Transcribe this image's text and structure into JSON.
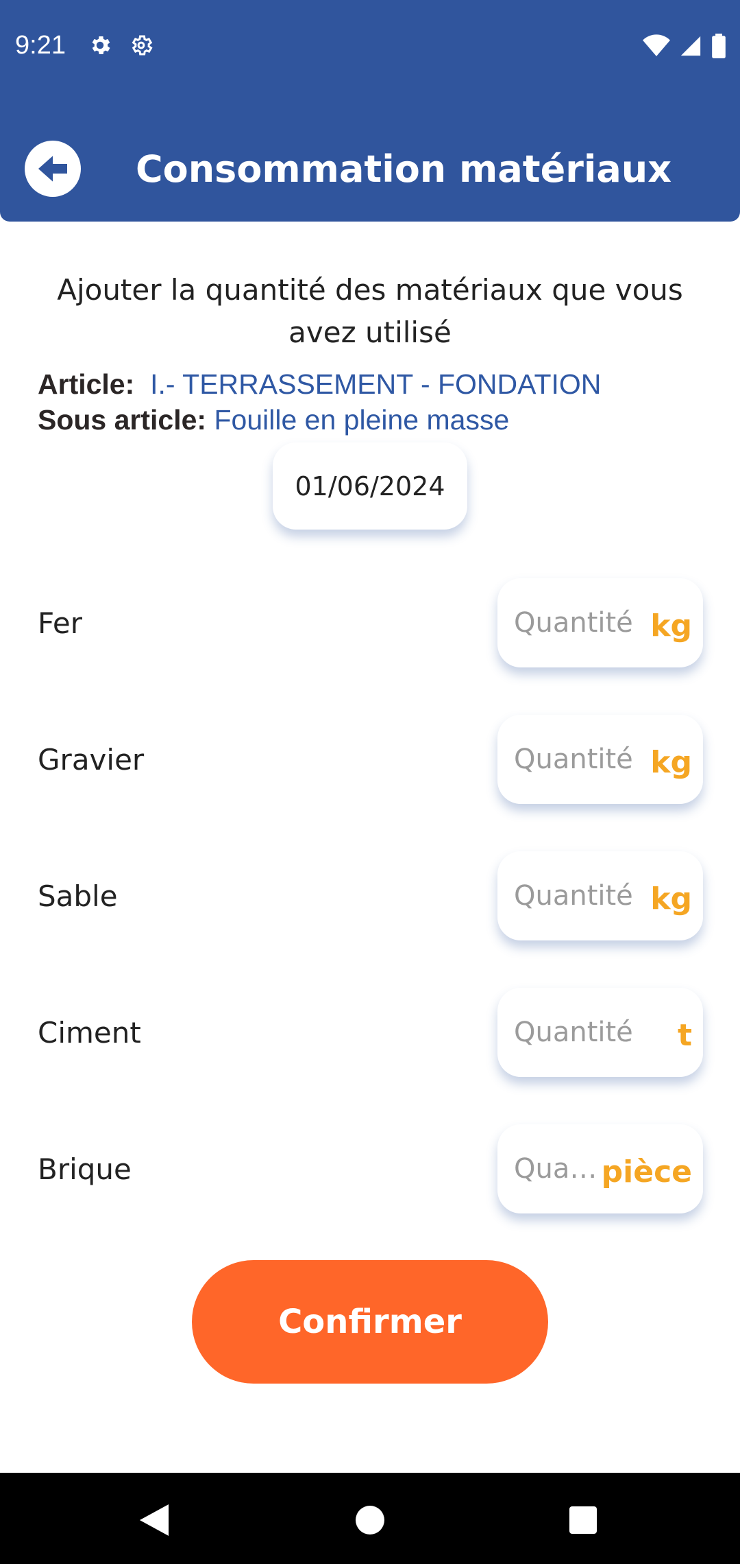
{
  "status_bar": {
    "time": "9:21",
    "left_icons": [
      "settings-gear-icon",
      "settings-gear-outline-icon"
    ],
    "right_icons": [
      "wifi-icon",
      "signal-icon",
      "battery-icon"
    ]
  },
  "app_bar": {
    "title": "Consommation matériaux",
    "back_icon": "arrow-left-circle-icon"
  },
  "form": {
    "instruction": "Ajouter la quantité des matériaux que vous avez utilisé",
    "article_label": "Article:",
    "article_value": "I.- TERRASSEMENT - FONDATION",
    "sous_article_label": "Sous article:",
    "sous_article_value": "Fouille en pleine masse",
    "date": "01/06/2024",
    "materials": [
      {
        "name": "Fer",
        "placeholder": "Quantité",
        "unit": "kg",
        "value": ""
      },
      {
        "name": "Gravier",
        "placeholder": "Quantité",
        "unit": "kg",
        "value": ""
      },
      {
        "name": "Sable",
        "placeholder": "Quantité",
        "unit": "kg",
        "value": ""
      },
      {
        "name": "Ciment",
        "placeholder": "Quantité",
        "unit": "t",
        "value": ""
      },
      {
        "name": "Brique",
        "placeholder": "Qua…",
        "unit": "pièce",
        "value": ""
      }
    ],
    "confirm_label": "Confirmer"
  },
  "colors": {
    "header": "#30559d",
    "accent_link": "#2f58a4",
    "unit": "#f5a623",
    "confirm": "#ff6629"
  },
  "nav_bar": {
    "buttons": [
      "back-triangle-icon",
      "home-circle-icon",
      "recents-square-icon"
    ]
  }
}
